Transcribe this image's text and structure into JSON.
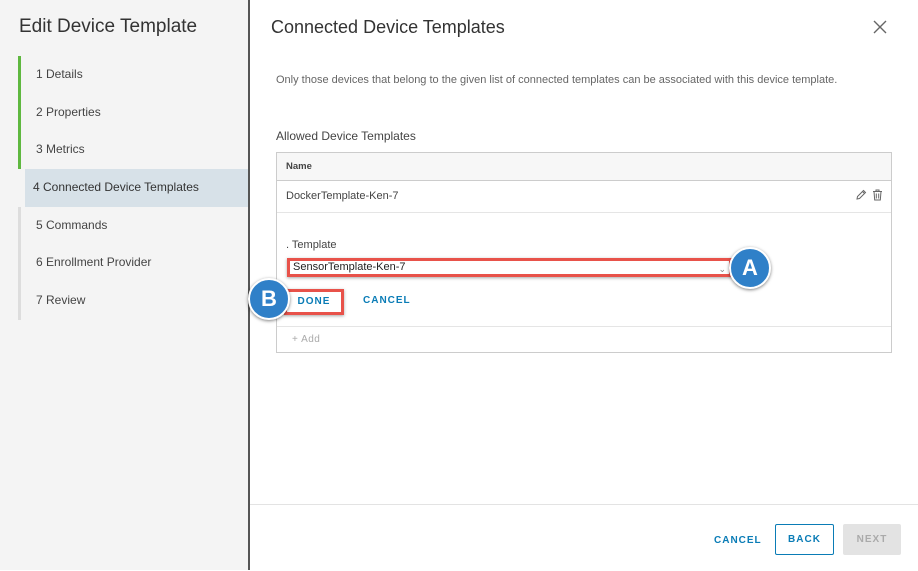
{
  "sidebar": {
    "title": "Edit Device Template",
    "steps": [
      {
        "label": "1 Details",
        "state": "done"
      },
      {
        "label": "2 Properties",
        "state": "done"
      },
      {
        "label": "3 Metrics",
        "state": "done"
      },
      {
        "label": "4 Connected Device Templates",
        "state": "active"
      },
      {
        "label": "5 Commands",
        "state": "pending"
      },
      {
        "label": "6 Enrollment Provider",
        "state": "pending"
      },
      {
        "label": "7 Review",
        "state": "pending"
      }
    ]
  },
  "main": {
    "title": "Connected Device Templates",
    "description": "Only those devices that belong to the given list of connected templates can be associated with this device template.",
    "allowed_label": "Allowed Device Templates",
    "table": {
      "header_name": "Name",
      "rows": [
        {
          "name": "DockerTemplate-Ken-7"
        }
      ],
      "edit": {
        "template_label": ". Template",
        "selected_value": "SensorTemplate-Ken-7",
        "done_label": "DONE",
        "cancel_label": "CANCEL"
      },
      "add_label": "+ Add"
    }
  },
  "callouts": {
    "a": "A",
    "b": "B"
  },
  "footer": {
    "cancel_label": "CANCEL",
    "back_label": "BACK",
    "next_label": "NEXT"
  },
  "colors": {
    "accent": "#0a7cb6",
    "highlight": "#e8524a",
    "callout": "#2f80c8",
    "step_done": "#5fb840"
  }
}
